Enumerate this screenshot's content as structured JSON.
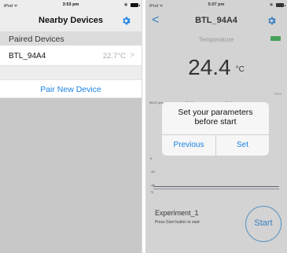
{
  "left": {
    "statusbar": {
      "carrier": "iPod ᯤ",
      "time": "3:53 pm",
      "bluetooth": "∗"
    },
    "nav": {
      "title": "Nearby Devices"
    },
    "section": {
      "header": "Paired Devices"
    },
    "device": {
      "name": "BTL_94A4",
      "temperature": "22.7°C",
      "chevron": ">"
    },
    "pair_button": "Pair New Device"
  },
  "right": {
    "statusbar": {
      "carrier": "iPod ᯤ",
      "time": "5:07 pm",
      "bluetooth": "∗"
    },
    "nav": {
      "title": "BTL_94A4",
      "back": "<"
    },
    "temperature_label": "Temperature",
    "temperature_value": "24.4",
    "temperature_unit": "°C",
    "time_axis_label": "Time",
    "graph_times": [
      "05:07 pm",
      "05:09 pm",
      "05:11 pm"
    ],
    "y_labels": [
      "0",
      "-20",
      "-40"
    ],
    "y_unit": "°C",
    "dialog": {
      "message": "Set your parameters before start",
      "previous_label": "Previous",
      "set_label": "Set"
    },
    "experiment_name": "Experiment_1",
    "experiment_hint": "Press Start button to start",
    "start_label": "Start"
  },
  "colors": {
    "accent": "#1a82e6",
    "battery": "#2fb54a",
    "overlay": "#c8c8c8"
  }
}
